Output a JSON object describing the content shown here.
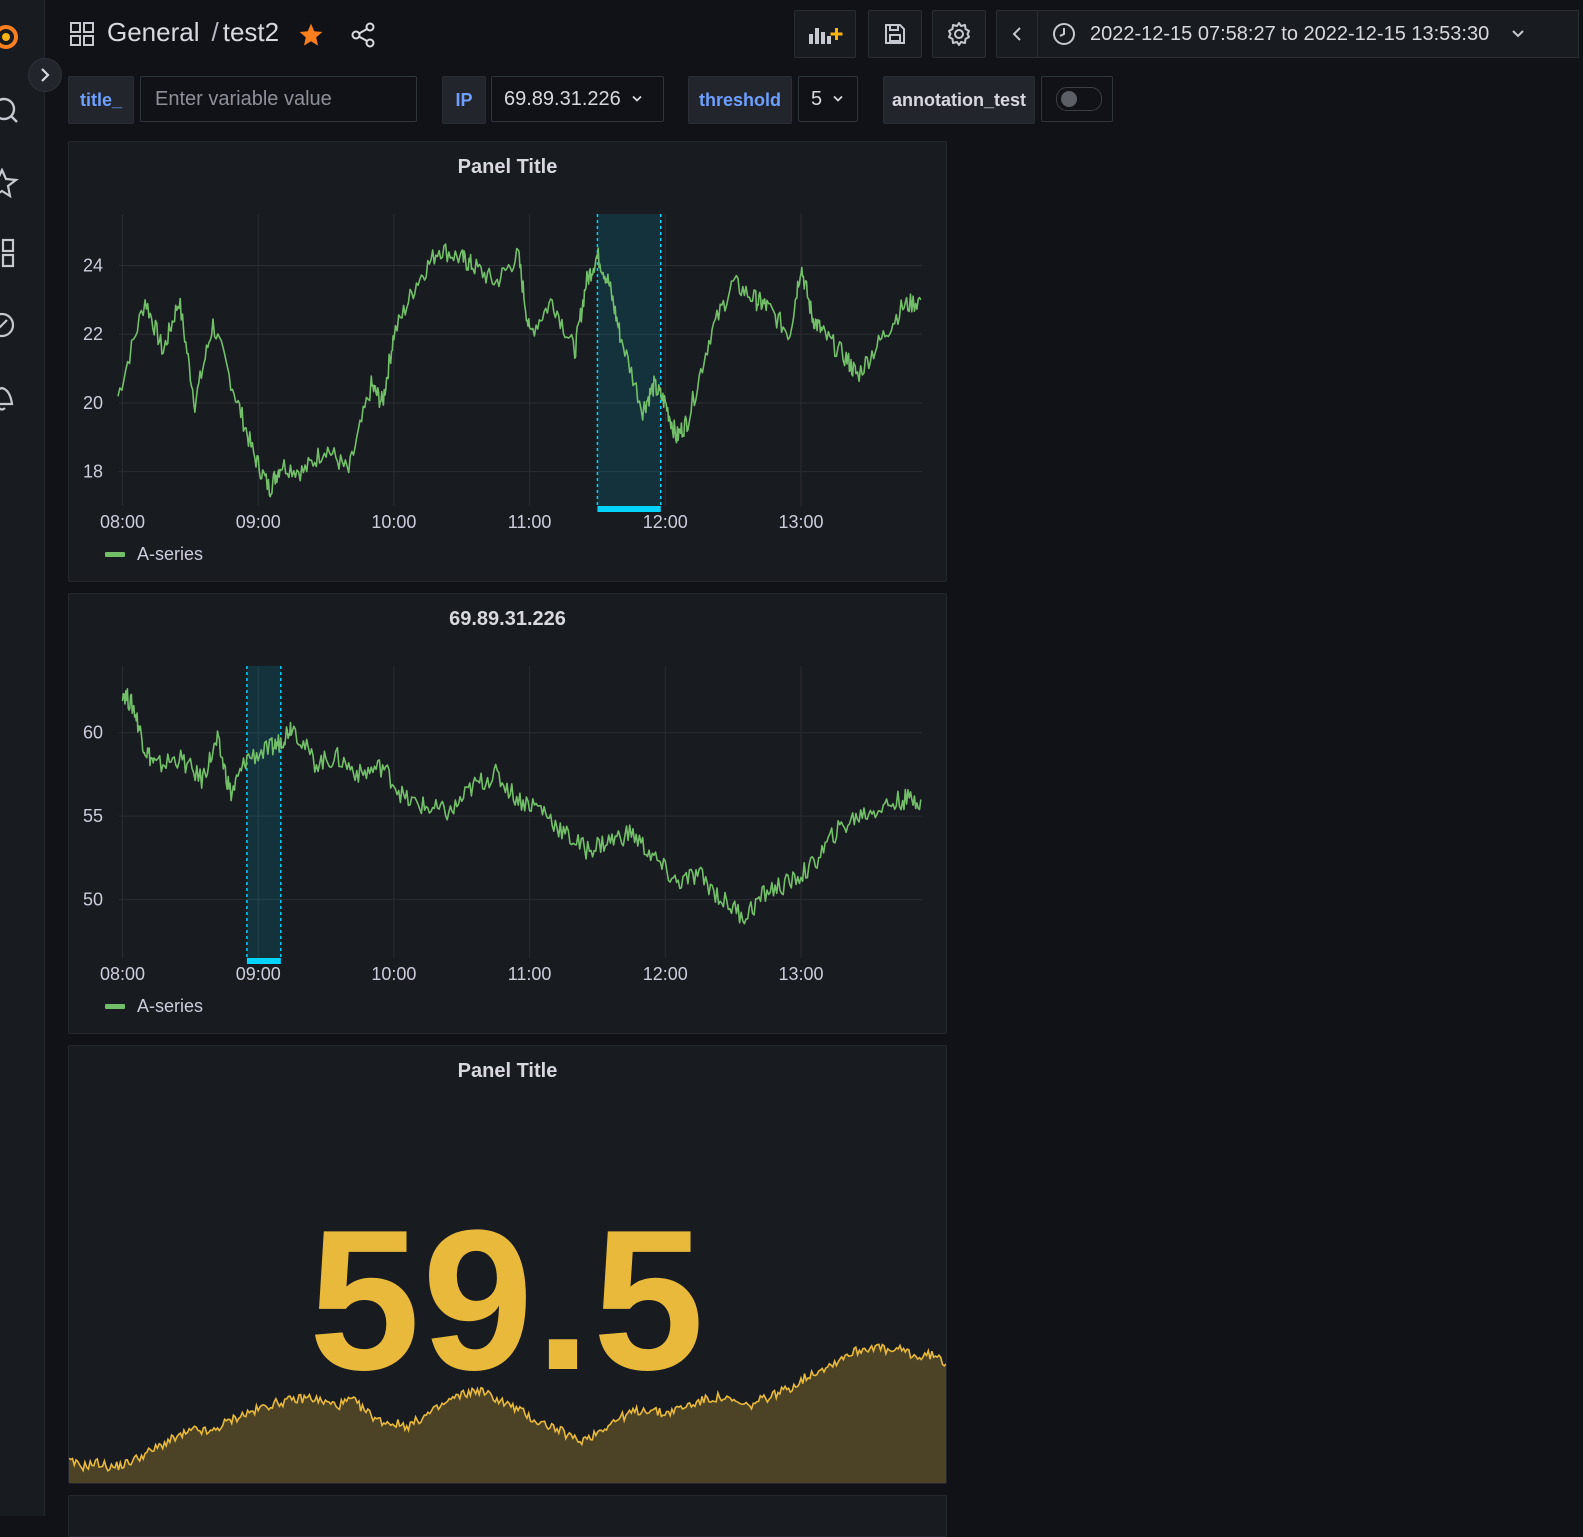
{
  "topbar": {
    "folder": "General",
    "separator": "/",
    "dashboard": "test2",
    "time_range": "2022-12-15 07:58:27 to 2022-12-15 13:53:30"
  },
  "variables": {
    "title_label": "title_",
    "title_placeholder": "Enter variable value",
    "ip_label": "IP",
    "ip_value": "69.89.31.226",
    "threshold_label": "threshold",
    "threshold_value": "5",
    "annotation_label": "annotation_test"
  },
  "colors": {
    "series": "#73bf69",
    "annotation": "#00d4ff",
    "stat": "#e8b93a",
    "accent": "#f97e1e"
  },
  "chart_data": [
    {
      "type": "line",
      "title": "Panel Title",
      "legend": "A-series",
      "x_ticks": [
        "08:00",
        "09:00",
        "10:00",
        "11:00",
        "12:00",
        "13:00"
      ],
      "y_ticks": [
        18,
        20,
        22,
        24
      ],
      "ylim": [
        17,
        25.5
      ],
      "xlim_hours": [
        7.974,
        13.892
      ],
      "annotation": {
        "start": "11:30",
        "end": "11:58"
      },
      "grid": true,
      "series": [
        {
          "name": "A-series",
          "x": [
            "07:58",
            "08:10",
            "08:18",
            "08:25",
            "08:32",
            "08:40",
            "08:50",
            "08:58",
            "09:05",
            "09:10",
            "09:20",
            "09:30",
            "09:40",
            "09:50",
            "09:55",
            "10:00",
            "10:10",
            "10:20",
            "10:30",
            "10:35",
            "10:45",
            "10:55",
            "11:00",
            "11:10",
            "11:20",
            "11:25",
            "11:30",
            "11:35",
            "11:40",
            "11:50",
            "11:55",
            "12:00",
            "12:05",
            "12:10",
            "12:20",
            "12:30",
            "12:40",
            "12:45",
            "12:55",
            "13:00",
            "13:05",
            "13:10",
            "13:20",
            "13:25",
            "13:35",
            "13:45",
            "13:53"
          ],
          "y": [
            20.2,
            23.0,
            21.5,
            23.0,
            20.0,
            22.3,
            20.2,
            18.5,
            17.5,
            18.2,
            18.0,
            18.7,
            18.0,
            20.5,
            20.0,
            22.0,
            23.5,
            24.5,
            24.2,
            24.0,
            23.5,
            24.3,
            22.0,
            23.0,
            21.5,
            23.5,
            24.3,
            23.5,
            22.0,
            19.8,
            20.5,
            20.0,
            19.0,
            19.5,
            22.0,
            23.5,
            23.0,
            22.8,
            22.0,
            24.0,
            22.5,
            22.0,
            21.3,
            20.8,
            21.8,
            22.8,
            23.0
          ]
        }
      ]
    },
    {
      "type": "line",
      "title": "69.89.31.226",
      "legend": "A-series",
      "x_ticks": [
        "08:00",
        "09:00",
        "10:00",
        "11:00",
        "12:00",
        "13:00"
      ],
      "y_ticks": [
        50,
        55,
        60
      ],
      "ylim": [
        46.5,
        64
      ],
      "xlim_hours": [
        7.974,
        13.892
      ],
      "annotation": {
        "start": "08:55",
        "end": "09:10"
      },
      "grid": true,
      "series": [
        {
          "name": "A-series",
          "x": [
            "08:00",
            "08:05",
            "08:10",
            "08:15",
            "08:25",
            "08:35",
            "08:42",
            "08:48",
            "08:55",
            "09:05",
            "09:10",
            "09:15",
            "09:25",
            "09:35",
            "09:45",
            "09:55",
            "10:05",
            "10:15",
            "10:25",
            "10:35",
            "10:45",
            "10:55",
            "11:05",
            "11:15",
            "11:25",
            "11:35",
            "11:45",
            "11:55",
            "12:05",
            "12:15",
            "12:25",
            "12:35",
            "12:45",
            "12:55",
            "13:05",
            "13:15",
            "13:25",
            "13:35",
            "13:45",
            "13:53"
          ],
          "y": [
            62.5,
            61.5,
            59.0,
            58.0,
            58.5,
            57.2,
            59.5,
            56.3,
            58.5,
            59.0,
            59.5,
            60.5,
            58.2,
            58.5,
            57.5,
            58.0,
            56.0,
            55.5,
            55.2,
            56.8,
            57.5,
            56.0,
            55.5,
            54.0,
            53.0,
            53.5,
            54.0,
            52.5,
            51.0,
            51.5,
            50.0,
            49.0,
            50.5,
            51.0,
            52.0,
            54.0,
            55.0,
            55.5,
            56.0,
            56.0
          ]
        }
      ]
    },
    {
      "type": "area",
      "title": "Panel Title",
      "value": "59.5",
      "series": [
        {
          "values": [
            18,
            14,
            17,
            13,
            16,
            22,
            28,
            35,
            40,
            45,
            42,
            50,
            56,
            60,
            65,
            68,
            70,
            72,
            68,
            65,
            70,
            60,
            52,
            50,
            48,
            55,
            62,
            70,
            75,
            78,
            72,
            66,
            60,
            52,
            48,
            42,
            35,
            40,
            48,
            55,
            60,
            62,
            58,
            62,
            66,
            70,
            72,
            68,
            64,
            70,
            75,
            80,
            88,
            95,
            100,
            108,
            112,
            115,
            110,
            112,
            105,
            108,
            100
          ]
        }
      ]
    }
  ]
}
